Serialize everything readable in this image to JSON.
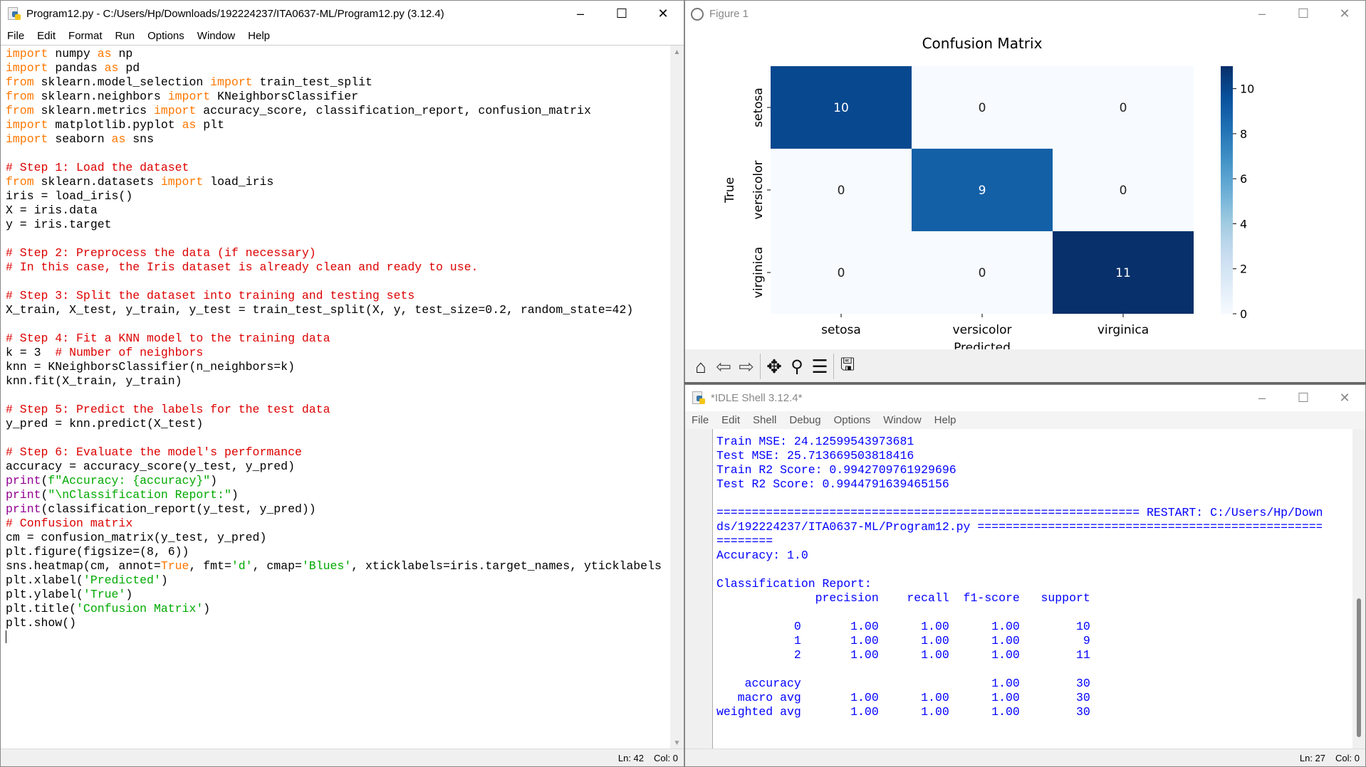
{
  "editor": {
    "title": "Program12.py - C:/Users/Hp/Downloads/192224237/ITA0637-ML/Program12.py (3.12.4)",
    "menu": [
      "File",
      "Edit",
      "Format",
      "Run",
      "Options",
      "Window",
      "Help"
    ],
    "status": {
      "line": "Ln: 42",
      "col": "Col: 0"
    },
    "code": [
      [
        [
          "import",
          "kw"
        ],
        [
          " numpy ",
          ""
        ],
        [
          "as",
          "kw"
        ],
        [
          " np",
          ""
        ]
      ],
      [
        [
          "import",
          "kw"
        ],
        [
          " pandas ",
          ""
        ],
        [
          "as",
          "kw"
        ],
        [
          " pd",
          ""
        ]
      ],
      [
        [
          "from",
          "kw"
        ],
        [
          " sklearn.model_selection ",
          ""
        ],
        [
          "import",
          "kw"
        ],
        [
          " train_test_split",
          ""
        ]
      ],
      [
        [
          "from",
          "kw"
        ],
        [
          " sklearn.neighbors ",
          ""
        ],
        [
          "import",
          "kw"
        ],
        [
          " KNeighborsClassifier",
          ""
        ]
      ],
      [
        [
          "from",
          "kw"
        ],
        [
          " sklearn.metrics ",
          ""
        ],
        [
          "import",
          "kw"
        ],
        [
          " accuracy_score, classification_report, confusion_matrix",
          ""
        ]
      ],
      [
        [
          "import",
          "kw"
        ],
        [
          " matplotlib.pyplot ",
          ""
        ],
        [
          "as",
          "kw"
        ],
        [
          " plt",
          ""
        ]
      ],
      [
        [
          "import",
          "kw"
        ],
        [
          " seaborn ",
          ""
        ],
        [
          "as",
          "kw"
        ],
        [
          " sns",
          ""
        ]
      ],
      [],
      [
        [
          "# Step 1: Load the dataset",
          "cm"
        ]
      ],
      [
        [
          "from",
          "kw"
        ],
        [
          " sklearn.datasets ",
          ""
        ],
        [
          "import",
          "kw"
        ],
        [
          " load_iris",
          ""
        ]
      ],
      [
        [
          "iris = load_iris()",
          ""
        ]
      ],
      [
        [
          "X = iris.data",
          ""
        ]
      ],
      [
        [
          "y = iris.target",
          ""
        ]
      ],
      [],
      [
        [
          "# Step 2: Preprocess the data (if necessary)",
          "cm"
        ]
      ],
      [
        [
          "# In this case, the Iris dataset is already clean and ready to use.",
          "cm"
        ]
      ],
      [],
      [
        [
          "# Step 3: Split the dataset into training and testing sets",
          "cm"
        ]
      ],
      [
        [
          "X_train, X_test, y_train, y_test = train_test_split(X, y, test_size=0.2, random_state=42)",
          ""
        ]
      ],
      [],
      [
        [
          "# Step 4: Fit a KNN model to the training data",
          "cm"
        ]
      ],
      [
        [
          "k = 3  ",
          ""
        ],
        [
          "# Number of neighbors",
          "cm"
        ]
      ],
      [
        [
          "knn = KNeighborsClassifier(n_neighbors=k)",
          ""
        ]
      ],
      [
        [
          "knn.fit(X_train, y_train)",
          ""
        ]
      ],
      [],
      [
        [
          "# Step 5: Predict the labels for the test data",
          "cm"
        ]
      ],
      [
        [
          "y_pred = knn.predict(X_test)",
          ""
        ]
      ],
      [],
      [
        [
          "# Step 6: Evaluate the model's performance",
          "cm"
        ]
      ],
      [
        [
          "accuracy = accuracy_score(y_test, y_pred)",
          ""
        ]
      ],
      [
        [
          "print",
          "bi"
        ],
        [
          "(",
          ""
        ],
        [
          "f\"Accuracy: {accuracy}\"",
          "st"
        ],
        [
          ")",
          ""
        ]
      ],
      [
        [
          "print",
          "bi"
        ],
        [
          "(",
          ""
        ],
        [
          "\"\\nClassification Report:\"",
          "st"
        ],
        [
          ")",
          ""
        ]
      ],
      [
        [
          "print",
          "bi"
        ],
        [
          "(classification_report(y_test, y_pred))",
          ""
        ]
      ],
      [
        [
          "# Confusion matrix",
          "cm"
        ]
      ],
      [
        [
          "cm = confusion_matrix(y_test, y_pred)",
          ""
        ]
      ],
      [
        [
          "plt.figure(figsize=(8, 6))",
          ""
        ]
      ],
      [
        [
          "sns.heatmap(cm, annot=",
          ""
        ],
        [
          "True",
          "kw"
        ],
        [
          ", fmt=",
          ""
        ],
        [
          "'d'",
          "st"
        ],
        [
          ", cmap=",
          ""
        ],
        [
          "'Blues'",
          "st"
        ],
        [
          ", xticklabels=iris.target_names, yticklabels",
          ""
        ]
      ],
      [
        [
          "plt.xlabel(",
          ""
        ],
        [
          "'Predicted'",
          "st"
        ],
        [
          ")",
          ""
        ]
      ],
      [
        [
          "plt.ylabel(",
          ""
        ],
        [
          "'True'",
          "st"
        ],
        [
          ")",
          ""
        ]
      ],
      [
        [
          "plt.title(",
          ""
        ],
        [
          "'Confusion Matrix'",
          "st"
        ],
        [
          ")",
          ""
        ]
      ],
      [
        [
          "plt.show()",
          ""
        ]
      ]
    ]
  },
  "figure": {
    "title": "Figure 1",
    "toolbar": [
      "home-icon",
      "back-icon",
      "forward-icon",
      "pan-icon",
      "zoom-icon",
      "configure-icon",
      "save-icon"
    ]
  },
  "chart_data": {
    "type": "heatmap",
    "title": "Confusion Matrix",
    "xlabel": "Predicted",
    "ylabel": "True",
    "xticklabels": [
      "setosa",
      "versicolor",
      "virginica"
    ],
    "yticklabels": [
      "setosa",
      "versicolor",
      "virginica"
    ],
    "values": [
      [
        10,
        0,
        0
      ],
      [
        0,
        9,
        0
      ],
      [
        0,
        0,
        11
      ]
    ],
    "colormap": "Blues",
    "colorbar": {
      "range": [
        0,
        11
      ],
      "ticks": [
        "0",
        "2",
        "4",
        "6",
        "8",
        "10"
      ]
    }
  },
  "shell": {
    "title": "*IDLE Shell 3.12.4*",
    "menu": [
      "File",
      "Edit",
      "Shell",
      "Debug",
      "Options",
      "Window",
      "Help"
    ],
    "status": {
      "line": "Ln: 27",
      "col": "Col: 0"
    },
    "lines": [
      "Train MSE: 24.12599543973681",
      "Test MSE: 25.713669503818416",
      "Train R2 Score: 0.9942709761929696",
      "Test R2 Score: 0.9944791639465156",
      "",
      "============================================================ RESTART: C:/Users/Hp/Downloa",
      "ds/192224237/ITA0637-ML/Program12.py ==================================================",
      "========",
      "Accuracy: 1.0",
      "",
      "Classification Report:",
      "              precision    recall  f1-score   support",
      "",
      "           0       1.00      1.00      1.00        10",
      "           1       1.00      1.00      1.00         9",
      "           2       1.00      1.00      1.00        11",
      "",
      "    accuracy                           1.00        30",
      "   macro avg       1.00      1.00      1.00        30",
      "weighted avg       1.00      1.00      1.00        30"
    ]
  }
}
